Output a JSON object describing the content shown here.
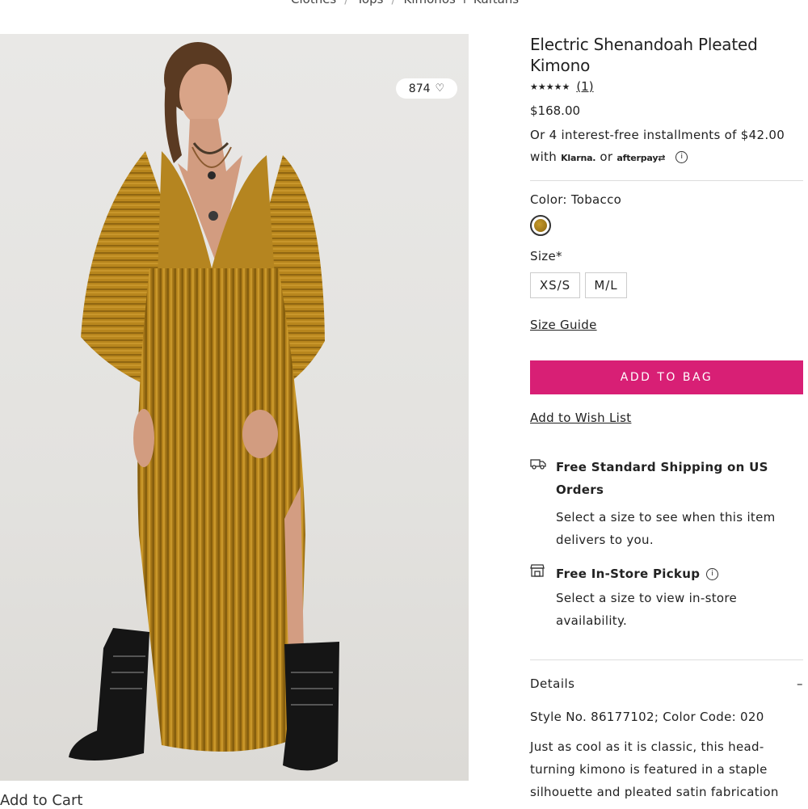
{
  "breadcrumb": [
    "Clothes",
    "Tops",
    "Kimonos + Kaftans"
  ],
  "product": {
    "like_count": "874",
    "title": "Electric Shenandoah Pleated Kimono",
    "stars": "★★★★★",
    "review_count": "(1)",
    "price": "$168.00",
    "installments_text": "Or 4 interest-free installments of $42.00",
    "with_text": "with",
    "or_text": "or",
    "klarna_label": "Klarna.",
    "afterpay_label": "afterpay",
    "color_label": "Color: Tobacco",
    "size_label": "Size*",
    "sizes": [
      "XS/S",
      "M/L"
    ],
    "size_guide": "Size Guide",
    "add_to_bag": "ADD TO BAG",
    "wish_list": "Add to Wish List",
    "shipping_title": "Free Standard Shipping on US Orders",
    "shipping_text": "Select a size to see when this item delivers to you.",
    "pickup_title": "Free In-Store Pickup",
    "pickup_text": "Select a size to view in-store availability.",
    "details_label": "Details",
    "details_toggle": "–",
    "style_no": "Style No. 86177102; Color Code: 020",
    "description": "Just as cool as it is classic, this head-turning kimono is featured in a staple silhouette and pleated satin fabrication"
  },
  "colors": {
    "accent": "#d81f75",
    "swatch": "#b08020"
  },
  "bottom_text": "Add to Cart"
}
